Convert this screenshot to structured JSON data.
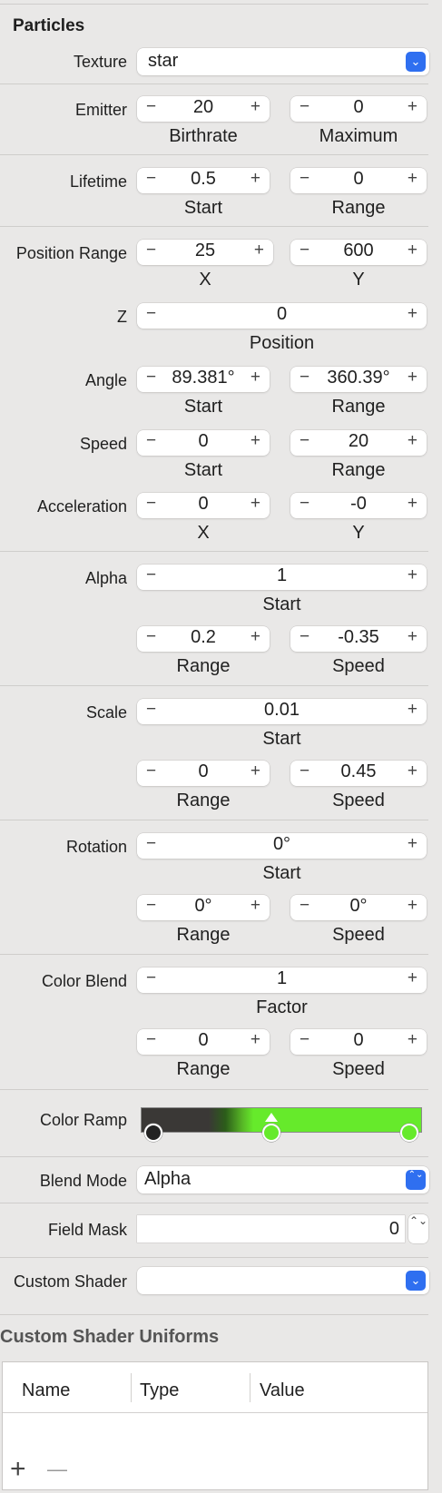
{
  "section_title": "Particles",
  "texture": {
    "label": "Texture",
    "value": "star"
  },
  "emitter": {
    "label": "Emitter",
    "birthrate": "20",
    "maximum": "0",
    "sub1": "Birthrate",
    "sub2": "Maximum"
  },
  "lifetime": {
    "label": "Lifetime",
    "start": "0.5",
    "range": "0",
    "sub1": "Start",
    "sub2": "Range"
  },
  "position_range": {
    "label": "Position Range",
    "x": "25",
    "y": "600",
    "sub1": "X",
    "sub2": "Y"
  },
  "z": {
    "label": "Z",
    "value": "0",
    "sub": "Position"
  },
  "angle": {
    "label": "Angle",
    "start": "89.381°",
    "range": "360.39°",
    "sub1": "Start",
    "sub2": "Range"
  },
  "speed": {
    "label": "Speed",
    "start": "0",
    "range": "20",
    "sub1": "Start",
    "sub2": "Range"
  },
  "acceleration": {
    "label": "Acceleration",
    "x": "0",
    "y": "-0",
    "sub1": "X",
    "sub2": "Y"
  },
  "alpha": {
    "label": "Alpha",
    "start": "1",
    "range": "0.2",
    "speed": "-0.35",
    "sub_start": "Start",
    "sub_range": "Range",
    "sub_speed": "Speed"
  },
  "scale": {
    "label": "Scale",
    "start": "0.01",
    "range": "0",
    "speed": "0.45",
    "sub_start": "Start",
    "sub_range": "Range",
    "sub_speed": "Speed"
  },
  "rotation": {
    "label": "Rotation",
    "start": "0°",
    "range": "0°",
    "speed": "0°",
    "sub_start": "Start",
    "sub_range": "Range",
    "sub_speed": "Speed"
  },
  "color_blend": {
    "label": "Color Blend",
    "factor": "1",
    "range": "0",
    "speed": "0",
    "sub_factor": "Factor",
    "sub_range": "Range",
    "sub_speed": "Speed"
  },
  "color_ramp": {
    "label": "Color Ramp",
    "stop_colors": [
      "#222222",
      "#66ea2b",
      "#66ea2b"
    ]
  },
  "blend_mode": {
    "label": "Blend Mode",
    "value": "Alpha"
  },
  "field_mask": {
    "label": "Field Mask",
    "value": "0"
  },
  "custom_shader": {
    "label": "Custom Shader",
    "value": ""
  },
  "uniforms": {
    "title": "Custom Shader Uniforms",
    "col_name": "Name",
    "col_type": "Type",
    "col_value": "Value"
  },
  "symbols": {
    "minus": "−",
    "plus": "+",
    "add": "+",
    "remove": "—",
    "chevron": "⌄",
    "updown": "⌃⌄"
  }
}
